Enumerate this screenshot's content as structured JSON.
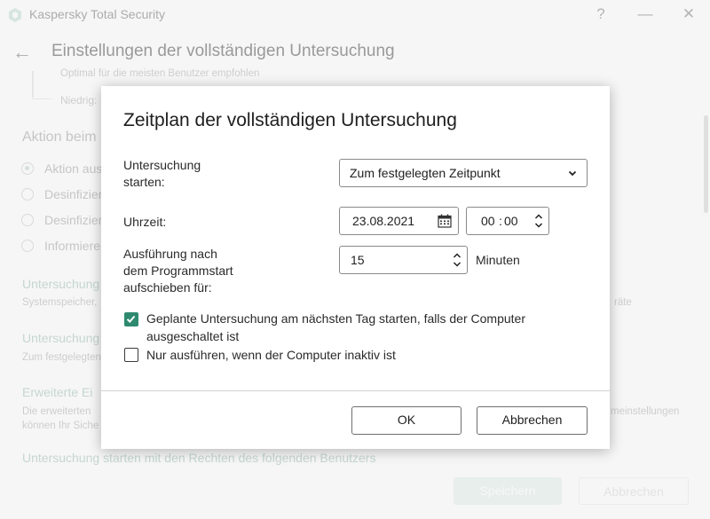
{
  "window": {
    "title": "Kaspersky Total Security",
    "help": "?",
    "minimize": "—",
    "close": "✕"
  },
  "header": {
    "title": "Einstellungen der vollständigen Untersuchung"
  },
  "background": {
    "level_line_1": "Optimal für die meisten Benutzer empfohlen",
    "level_low": "Niedrig:",
    "action_heading": "Aktion beim",
    "radios": [
      "Aktion aus",
      "Desinfizier",
      "Desinfizier",
      "Informiere"
    ],
    "section1_link": "Untersuchung",
    "section1_desc": "Systemspeicher,",
    "section1_desc_right": "räte",
    "section2_link": "Untersuchung",
    "section2_desc": "Zum festgelegten",
    "section3_link": "Erweiterte Ei",
    "section3_desc_1": "Die erweiterten",
    "section3_desc_1_right": "meinstellungen",
    "section3_desc_2": "können Ihr Siche",
    "section4_link": "Untersuchung starten mit den Rechten des folgenden Benutzers",
    "save_label": "Speichern",
    "cancel_label": "Abbrechen"
  },
  "dialog": {
    "title": "Zeitplan der vollständigen Untersuchung",
    "start_label_1": "Untersuchung",
    "start_label_2": "starten:",
    "start_value": "Zum festgelegten Zeitpunkt",
    "time_label": "Uhrzeit:",
    "date_value": "23.08.2021",
    "hour_value": "00",
    "minute_value": "00",
    "time_separator": ":",
    "delay_label_1": "Ausführung nach",
    "delay_label_2": "dem Programmstart",
    "delay_label_3": "aufschieben für:",
    "delay_value": "15",
    "delay_unit": "Minuten",
    "checkbox1_label_1": "Geplante Untersuchung am nächsten Tag starten, falls der Computer",
    "checkbox1_label_2": "ausgeschaltet ist",
    "checkbox1_checked": true,
    "checkbox2_label": "Nur ausführen, wenn der Computer inaktiv ist",
    "checkbox2_checked": false,
    "ok_label": "OK",
    "cancel_label": "Abbrechen"
  },
  "colors": {
    "accent": "#2e8a6f",
    "link_faded": "#9ab8ad"
  }
}
